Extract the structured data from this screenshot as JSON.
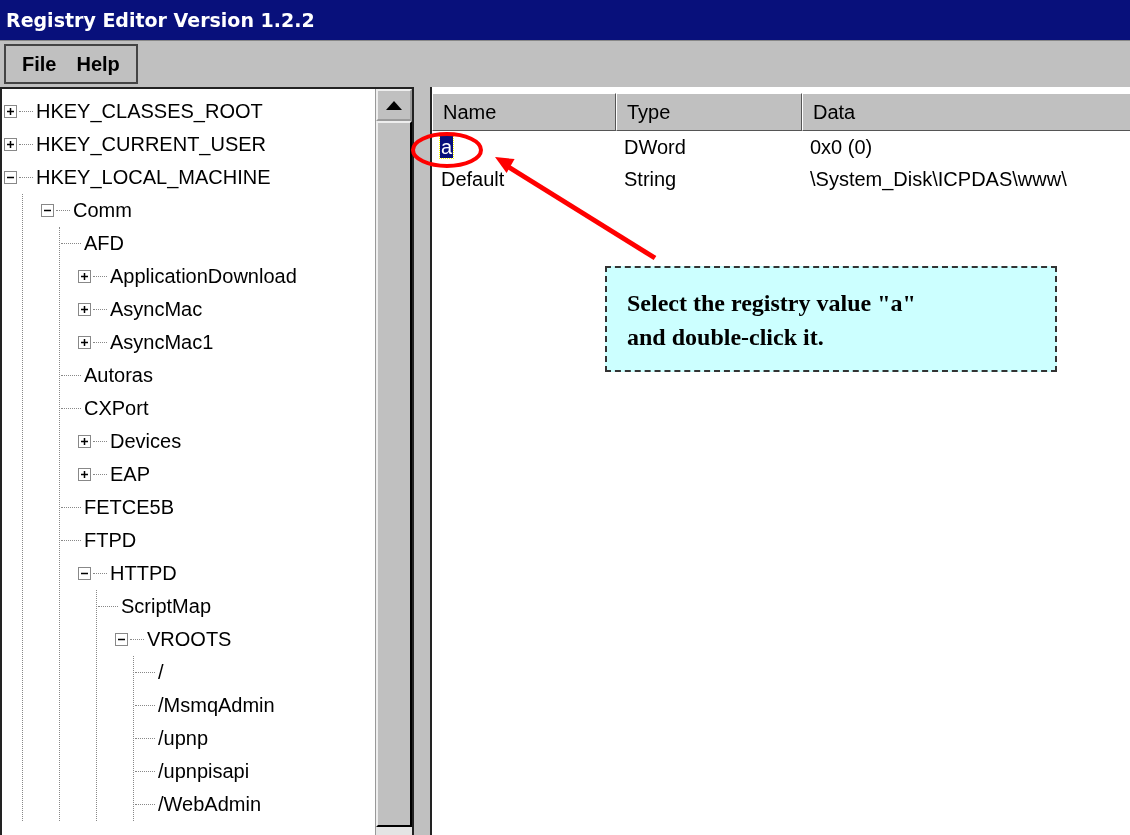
{
  "window": {
    "title": "Registry Editor Version 1.2.2"
  },
  "menu": [
    "File",
    "Help"
  ],
  "tree": [
    {
      "label": "HKEY_CLASSES_ROOT",
      "kind": "branch",
      "expanded": false
    },
    {
      "label": "HKEY_CURRENT_USER",
      "kind": "branch",
      "expanded": false
    },
    {
      "label": "HKEY_LOCAL_MACHINE",
      "kind": "branch",
      "expanded": true,
      "children": [
        {
          "label": "Comm",
          "kind": "branch",
          "expanded": true,
          "children": [
            {
              "label": "AFD",
              "kind": "leaf"
            },
            {
              "label": "ApplicationDownload",
              "kind": "branch",
              "expanded": false
            },
            {
              "label": "AsyncMac",
              "kind": "branch",
              "expanded": false
            },
            {
              "label": "AsyncMac1",
              "kind": "branch",
              "expanded": false
            },
            {
              "label": "Autoras",
              "kind": "leaf"
            },
            {
              "label": "CXPort",
              "kind": "leaf"
            },
            {
              "label": "Devices",
              "kind": "branch",
              "expanded": false
            },
            {
              "label": "EAP",
              "kind": "branch",
              "expanded": false
            },
            {
              "label": "FETCE5B",
              "kind": "leaf"
            },
            {
              "label": "FTPD",
              "kind": "leaf"
            },
            {
              "label": "HTTPD",
              "kind": "branch",
              "expanded": true,
              "children": [
                {
                  "label": "ScriptMap",
                  "kind": "leaf"
                },
                {
                  "label": "VROOTS",
                  "kind": "branch",
                  "expanded": true,
                  "children": [
                    {
                      "label": "/",
                      "kind": "leaf"
                    },
                    {
                      "label": "/MsmqAdmin",
                      "kind": "leaf"
                    },
                    {
                      "label": "/upnp",
                      "kind": "leaf"
                    },
                    {
                      "label": "/upnpisapi",
                      "kind": "leaf"
                    },
                    {
                      "label": "/WebAdmin",
                      "kind": "leaf"
                    }
                  ]
                }
              ]
            }
          ]
        }
      ]
    }
  ],
  "list": {
    "columns": [
      "Name",
      "Type",
      "Data"
    ],
    "rows": [
      {
        "name": "a",
        "type": "DWord",
        "data": "0x0 (0)",
        "selected": true
      },
      {
        "name": "Default",
        "type": "String",
        "data": "\\System_Disk\\ICPDAS\\www\\",
        "selected": false
      }
    ]
  },
  "callout": {
    "lines": [
      "Select the registry value \"a\"",
      "and double-click it."
    ]
  }
}
